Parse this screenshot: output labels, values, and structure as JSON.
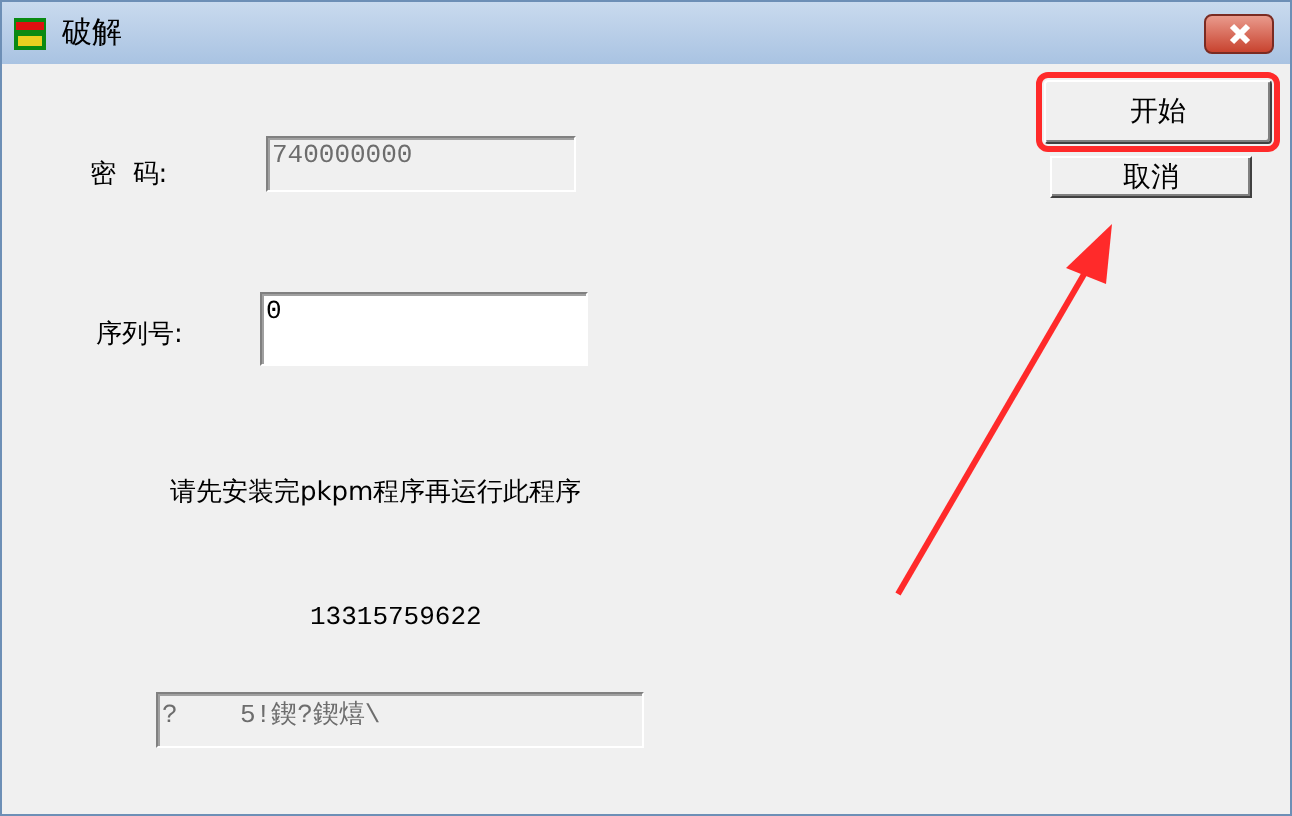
{
  "window": {
    "title": "破解"
  },
  "fields": [
    {
      "label": "密  码:",
      "value": "740000000",
      "disabled": true
    },
    {
      "label": "序列号:",
      "value": "0",
      "disabled": false
    }
  ],
  "message": "请先安装完pkpm程序再运行此程序",
  "number": "13315759622",
  "output": {
    "value": "?    5!鍥?鍥熺\\",
    "disabled": true
  },
  "buttons": [
    {
      "label": "开始",
      "highlighted": true
    },
    {
      "label": "取消",
      "highlighted": false
    }
  ]
}
